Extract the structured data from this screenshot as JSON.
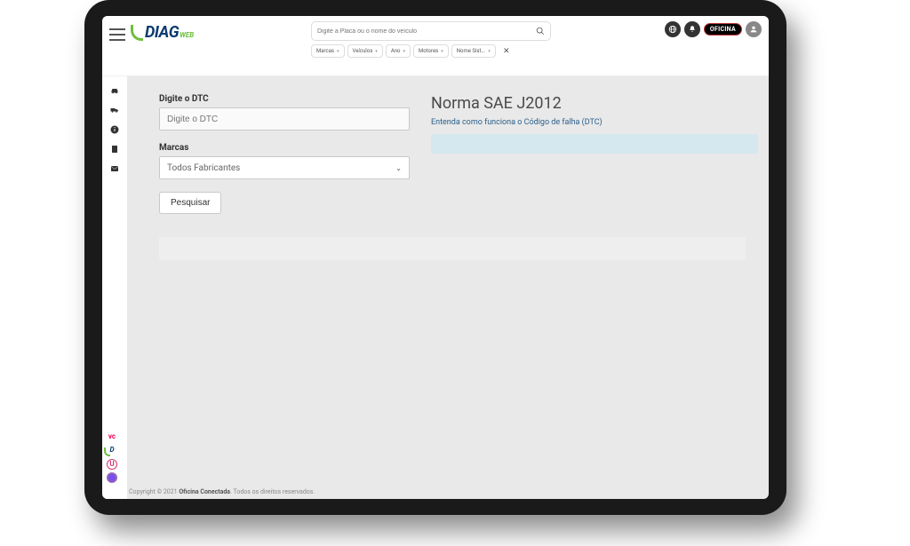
{
  "header": {
    "logo_main": "DIAG",
    "logo_sub": "WEB",
    "search_placeholder": "Digite a Placa ou o nome do veículo",
    "filters": [
      "Marcas",
      "Veículos",
      "Ano",
      "Motores",
      "Nome Sist..."
    ],
    "oficina_badge": "OFICINA"
  },
  "form": {
    "dtc_label": "Digite o DTC",
    "dtc_placeholder": "Digite o DTC",
    "marcas_label": "Marcas",
    "marcas_selected": "Todos Fabricantes",
    "search_button": "Pesquisar"
  },
  "norma": {
    "title": "Norma SAE J2012",
    "link": "Entenda como funciona o Código de falha (DTC)"
  },
  "footer": {
    "copyright_prefix": "Copyright © 2021 ",
    "company": "Oficina Conectada",
    "copyright_suffix": ". Todos os direitos reservados."
  }
}
